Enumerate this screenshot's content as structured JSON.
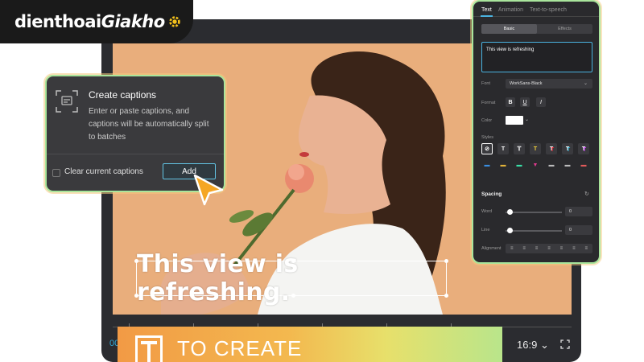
{
  "logo": {
    "part1": "dienthoai",
    "part2": "Giakho"
  },
  "captions_dialog": {
    "title": "Create captions",
    "description": "Enter or paste captions, and captions will be automatically split to batches",
    "checkbox_label": "Clear current captions",
    "add_button": "Add"
  },
  "video": {
    "caption_text": "This view is refreshing."
  },
  "timeline": {
    "left_label": "00"
  },
  "banner": {
    "text": "TO CREATE"
  },
  "aspect_ratio": {
    "value": "16:9"
  },
  "panel": {
    "tabs": [
      {
        "label": "Text",
        "active": true
      },
      {
        "label": "Animation",
        "active": false
      },
      {
        "label": "Text-to-speech",
        "active": false
      }
    ],
    "segments": [
      {
        "label": "Basic",
        "active": true
      },
      {
        "label": "Effects",
        "active": false
      }
    ],
    "text_value": "This view is refreshing",
    "font_label": "Font",
    "font_value": "WorkSans-Black",
    "format_label": "Format",
    "format_buttons": [
      "B",
      "U",
      "I"
    ],
    "color_label": "Color",
    "color_value": "#ffffff",
    "styles_label": "Styles",
    "spacing_title": "Spacing",
    "word_label": "Word",
    "word_value": "0",
    "line_label": "Line",
    "line_value": "0",
    "alignment_label": "Alignment"
  },
  "colors": {
    "accent_blue": "#4ab3e0",
    "highlight_border": "#a9e59c",
    "cursor": "#f5a623"
  }
}
